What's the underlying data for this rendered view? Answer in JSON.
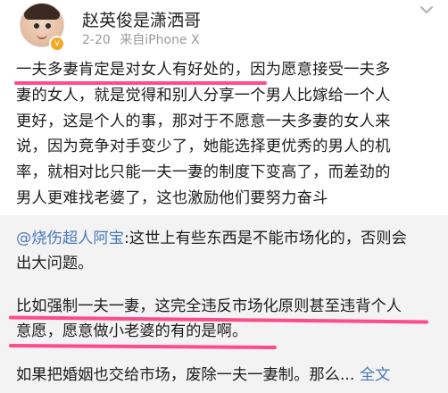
{
  "post": {
    "author": {
      "name": "赵英俊是潇洒哥",
      "verified_icon": "verified-badge-icon"
    },
    "meta": {
      "date": "2-20",
      "source": "来自iPhone X"
    },
    "body_lines": [
      "一夫多妻肯定是对女人有好处的，因为愿意接受一夫多",
      "妻的女人，就是觉得和别人分享一个男人比嫁给一个人",
      "更好，这是个人的事，那对于不愿意一夫多妻的女人来",
      "说，因为竞争对手变少了，她能选择更优秀的男人的机",
      "率，就相对比只能一夫一妻的制度下变高了，而差劲的",
      "男人更难找老婆了，这也激励他们要努力奋斗"
    ]
  },
  "retweet": {
    "mention": "@烧伤超人阿宝",
    "line1_rest": ":这世上有些东西是不能市场化的，否则会",
    "line2": "出大问题。",
    "line3": "比如强制一夫一妻，这完全违反市场化原则甚至违背个人",
    "line4": "意愿，愿意做小老婆的有的是啊。",
    "line5_text": "如果把婚姻也交给市场，废除一夫一妻制。那么...",
    "line5_link": "全文"
  },
  "colors": {
    "highlight_pink": "#ff2d7a",
    "link_blue": "#4a78b8",
    "meta_gray": "#9a9a9a",
    "retweet_bg": "#f3f3f4",
    "verified_orange": "#f5a623"
  }
}
